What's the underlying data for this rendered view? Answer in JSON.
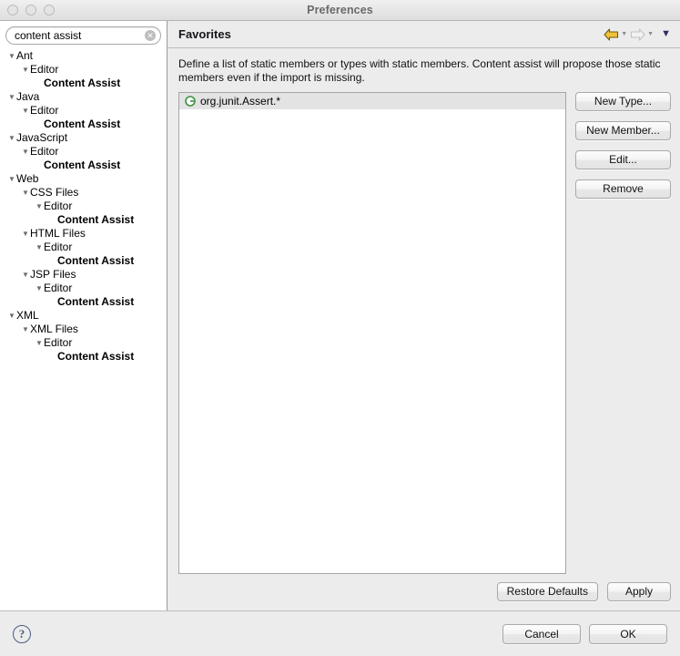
{
  "window": {
    "title": "Preferences",
    "traffic_lights": [
      "close",
      "minimize",
      "zoom"
    ]
  },
  "sidebar": {
    "search": {
      "value": "content assist",
      "placeholder": "type filter text",
      "clear_glyph": "✕"
    },
    "tree": [
      {
        "label": "Ant",
        "depth": 0,
        "expanded": true,
        "bold": false
      },
      {
        "label": "Editor",
        "depth": 1,
        "expanded": true,
        "bold": false
      },
      {
        "label": "Content Assist",
        "depth": 2,
        "expanded": false,
        "bold": true
      },
      {
        "label": "Java",
        "depth": 0,
        "expanded": true,
        "bold": false
      },
      {
        "label": "Editor",
        "depth": 1,
        "expanded": true,
        "bold": false
      },
      {
        "label": "Content Assist",
        "depth": 2,
        "expanded": false,
        "bold": true
      },
      {
        "label": "JavaScript",
        "depth": 0,
        "expanded": true,
        "bold": false
      },
      {
        "label": "Editor",
        "depth": 1,
        "expanded": true,
        "bold": false
      },
      {
        "label": "Content Assist",
        "depth": 2,
        "expanded": false,
        "bold": true
      },
      {
        "label": "Web",
        "depth": 0,
        "expanded": true,
        "bold": false
      },
      {
        "label": "CSS Files",
        "depth": 1,
        "expanded": true,
        "bold": false
      },
      {
        "label": "Editor",
        "depth": 2,
        "expanded": true,
        "bold": false
      },
      {
        "label": "Content Assist",
        "depth": 3,
        "expanded": false,
        "bold": true
      },
      {
        "label": "HTML Files",
        "depth": 1,
        "expanded": true,
        "bold": false
      },
      {
        "label": "Editor",
        "depth": 2,
        "expanded": true,
        "bold": false
      },
      {
        "label": "Content Assist",
        "depth": 3,
        "expanded": false,
        "bold": true
      },
      {
        "label": "JSP Files",
        "depth": 1,
        "expanded": true,
        "bold": false
      },
      {
        "label": "Editor",
        "depth": 2,
        "expanded": true,
        "bold": false
      },
      {
        "label": "Content Assist",
        "depth": 3,
        "expanded": false,
        "bold": true
      },
      {
        "label": "XML",
        "depth": 0,
        "expanded": true,
        "bold": false
      },
      {
        "label": "XML Files",
        "depth": 1,
        "expanded": true,
        "bold": false
      },
      {
        "label": "Editor",
        "depth": 2,
        "expanded": true,
        "bold": false
      },
      {
        "label": "Content Assist",
        "depth": 3,
        "expanded": false,
        "bold": true
      }
    ]
  },
  "pane": {
    "title": "Favorites",
    "description": "Define a list of static members or types with static members. Content assist will propose those static members even if the import is missing.",
    "nav": {
      "back_icon": "back-arrow-icon",
      "forward_icon": "forward-arrow-icon",
      "menu_icon": "chevron-down-icon",
      "dropdown_glyph": "▼"
    },
    "list": {
      "items": [
        {
          "icon": "green-g-icon",
          "label": "org.junit.Assert.*",
          "selected": true
        }
      ]
    },
    "side_buttons": [
      {
        "label": "New Type...",
        "name": "new-type-button"
      },
      {
        "label": "New Member...",
        "name": "new-member-button"
      },
      {
        "label": "Edit...",
        "name": "edit-button"
      },
      {
        "label": "Remove",
        "name": "remove-button"
      }
    ],
    "footer_buttons": [
      {
        "label": "Restore Defaults",
        "name": "restore-defaults-button"
      },
      {
        "label": "Apply",
        "name": "apply-button"
      }
    ]
  },
  "bottom": {
    "help_glyph": "?",
    "buttons": [
      {
        "label": "Cancel",
        "name": "cancel-button"
      },
      {
        "label": "OK",
        "name": "ok-button"
      }
    ]
  },
  "colors": {
    "window_bg": "#ececec",
    "sidebar_bg": "#ffffff",
    "selection_bg": "#e3e3e3",
    "back_arrow": "#e8b923",
    "forward_arrow": "#dcdcdc",
    "menu_arrow": "#2d2d66",
    "green_icon": "#3d9140",
    "help_icon": "#4a5f7e"
  }
}
